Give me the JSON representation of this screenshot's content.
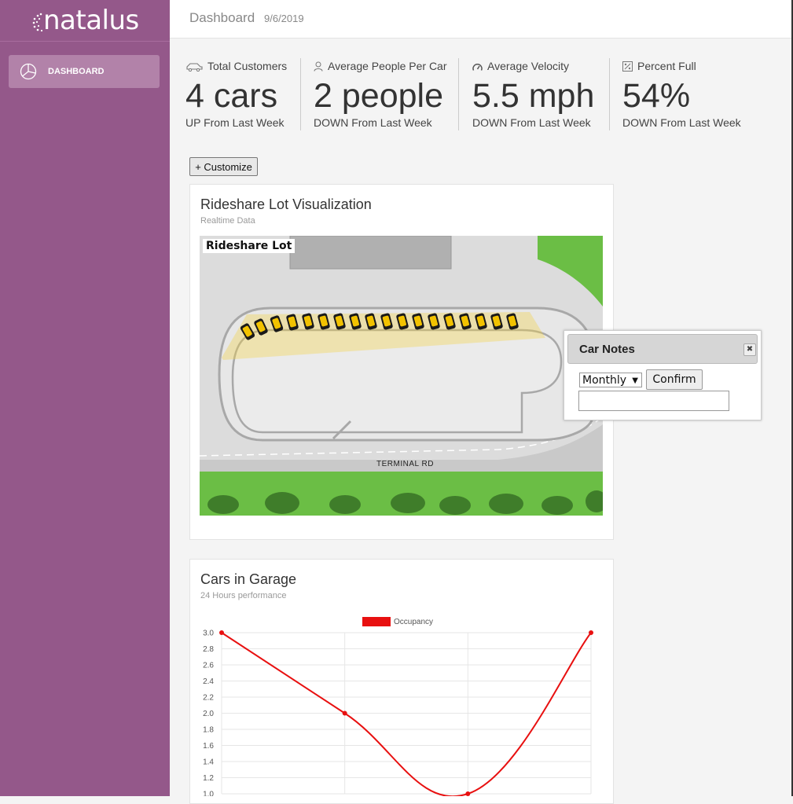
{
  "sidebar": {
    "logo": "natalus",
    "nav": [
      {
        "label": "DASHBOARD",
        "icon": "pie-chart-icon"
      }
    ]
  },
  "header": {
    "title": "Dashboard",
    "date": "9/6/2019"
  },
  "stats": [
    {
      "icon": "car-icon",
      "label": "Total Customers",
      "value": "4 cars",
      "trend": "UP From Last Week"
    },
    {
      "icon": "person-icon",
      "label": "Average People Per Car",
      "value": "2 people",
      "trend": "DOWN From Last Week"
    },
    {
      "icon": "speedometer-icon",
      "label": "Average Velocity",
      "value": "5.5 mph",
      "trend": "DOWN From Last Week"
    },
    {
      "icon": "percent-icon",
      "label": "Percent Full",
      "value": "54%",
      "trend": "DOWN From Last Week"
    }
  ],
  "customize_label": "+ Customize",
  "lot_card": {
    "title": "Rideshare Lot Visualization",
    "subtitle": "Realtime Data",
    "map_label": "Rideshare Lot",
    "road_label": "TERMINAL RD"
  },
  "dialog": {
    "title": "Car Notes",
    "close": "✖",
    "select_value": "Monthly",
    "confirm_label": "Confirm",
    "notes_value": ""
  },
  "garage_card": {
    "title": "Cars in Garage",
    "subtitle": "24 Hours performance"
  },
  "chart_data": {
    "type": "line",
    "series": [
      {
        "name": "Occupancy",
        "color": "#e81010",
        "values": [
          3.0,
          2.0,
          1.0,
          3.0
        ]
      }
    ],
    "x": [
      0,
      1,
      2,
      3
    ],
    "y_ticks": [
      "3.0",
      "2.8",
      "2.6",
      "2.4",
      "2.2",
      "2.0",
      "1.8",
      "1.6",
      "1.4",
      "1.2",
      "1.0"
    ],
    "ylim": [
      1.0,
      3.0
    ],
    "grid": true,
    "legend": "top-center"
  },
  "colors": {
    "sidebar": "#94588a",
    "nav_active": "#b282a9",
    "series": "#e81010",
    "grass": "#6bbe45"
  }
}
